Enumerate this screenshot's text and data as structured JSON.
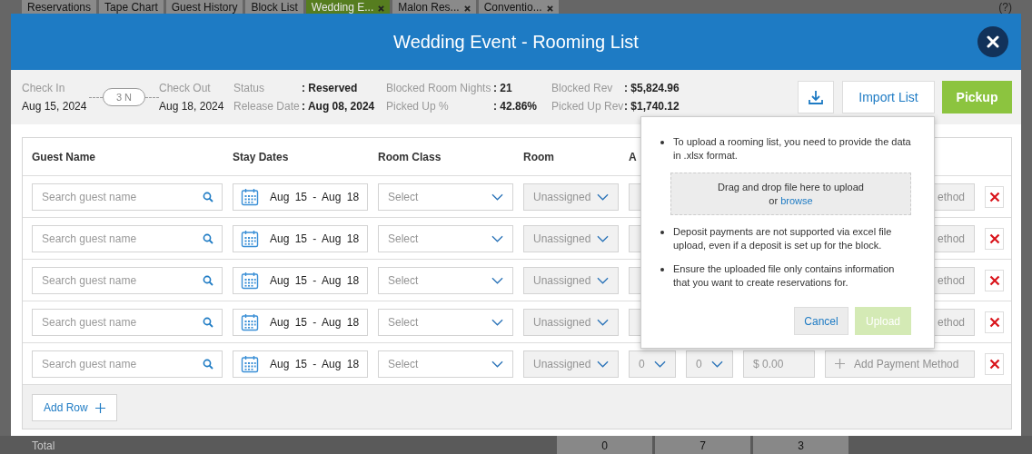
{
  "background_tabs": [
    {
      "label": "Reservations",
      "selected": false,
      "closable": false
    },
    {
      "label": "Tape Chart",
      "selected": false,
      "closable": false
    },
    {
      "label": "Guest History",
      "selected": false,
      "closable": false
    },
    {
      "label": "Block List",
      "selected": false,
      "closable": false
    },
    {
      "label": "Wedding E...",
      "selected": true,
      "closable": true
    },
    {
      "label": "Malon Res...",
      "selected": false,
      "closable": true
    },
    {
      "label": "Conventio...",
      "selected": false,
      "closable": true
    }
  ],
  "help_label": "(?)",
  "modal": {
    "title": "Wedding Event - Rooming List"
  },
  "summary": {
    "check_in": {
      "label": "Check In",
      "value": "Aug 15, 2024"
    },
    "nights": "3 N",
    "check_out": {
      "label": "Check Out",
      "value": "Aug 18, 2024"
    },
    "columns": [
      [
        {
          "label": "Status",
          "value": ": Reserved"
        },
        {
          "label": "Release Date",
          "value": ": Aug 08, 2024"
        }
      ],
      [
        {
          "label": "Blocked Room Nights",
          "value": ": 21"
        },
        {
          "label": "Picked Up %",
          "value": ": 42.86%"
        }
      ],
      [
        {
          "label": "Blocked Rev",
          "value": ": $5,824.96"
        },
        {
          "label": "Picked Up Rev",
          "value": ": $1,740.12"
        }
      ]
    ]
  },
  "actions": {
    "import_label": "Import List",
    "pickup_label": "Pickup"
  },
  "table": {
    "columns": [
      "Guest Name",
      "Stay Dates",
      "Room Class",
      "Room",
      "A"
    ],
    "rows": [
      {
        "guest_placeholder": "Search guest name",
        "dates": "Aug 15 - Aug 18",
        "room_class_placeholder": "Select",
        "room": "Unassigned",
        "payment": "ethod",
        "payment_plus": false
      },
      {
        "guest_placeholder": "Search guest name",
        "dates": "Aug 15 - Aug 18",
        "room_class_placeholder": "Select",
        "room": "Unassigned",
        "payment": "ethod",
        "payment_plus": false
      },
      {
        "guest_placeholder": "Search guest name",
        "dates": "Aug 15 - Aug 18",
        "room_class_placeholder": "Select",
        "room": "Unassigned",
        "payment": "ethod",
        "payment_plus": false
      },
      {
        "guest_placeholder": "Search guest name",
        "dates": "Aug 15 - Aug 18",
        "room_class_placeholder": "Select",
        "room": "Unassigned",
        "payment": "ethod",
        "payment_plus": false
      },
      {
        "guest_placeholder": "Search guest name",
        "dates": "Aug 15 - Aug 18",
        "room_class_placeholder": "Select",
        "room": "Unassigned",
        "adults": "0",
        "children": "0",
        "amount": "$ 0.00",
        "payment": "Add Payment Method",
        "payment_plus": true
      }
    ],
    "add_row": "Add Row"
  },
  "popup": {
    "notes": [
      "To upload a rooming list, you need to provide the data in .xlsx format.",
      "Deposit payments are not supported via excel file upload, even if a deposit is set up for the block.",
      "Ensure the uploaded file only contains information that you want to create reservations for."
    ],
    "drop_text": "Drag and drop file here to upload",
    "drop_or": "or",
    "browse": "browse",
    "cancel": "Cancel",
    "upload": {
      "label": "Upload",
      "disabled": true
    }
  },
  "footer_behind": {
    "label": "Total",
    "values": [
      "0",
      "7",
      "3"
    ]
  }
}
